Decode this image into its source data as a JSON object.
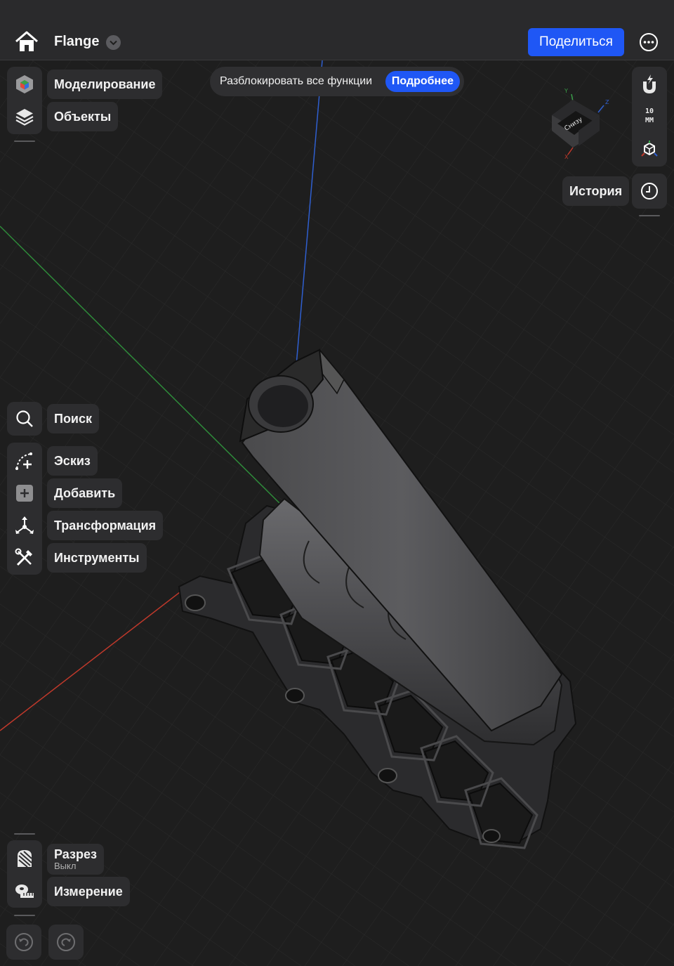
{
  "header": {
    "title": "Flange",
    "share_label": "Поделиться"
  },
  "banner": {
    "text": "Разблокировать все функции",
    "more_label": "Подробнее"
  },
  "top_left_menu": {
    "modeling_label": "Моделирование",
    "objects_label": "Объекты"
  },
  "tools_menu": {
    "search_label": "Поиск",
    "sketch_label": "Эскиз",
    "add_label": "Добавить",
    "transform_label": "Трансформация",
    "tools_label": "Инструменты"
  },
  "bottom_menu": {
    "section_label": "Разрез",
    "section_state": "Выкл",
    "measure_label": "Измерение"
  },
  "right_panel": {
    "units_value": "10",
    "units_label": "ММ",
    "history_label": "История",
    "view_cube_face": "Снизу"
  },
  "colors": {
    "accent": "#1f57f5",
    "panel": "#2d2d2f",
    "background": "#1e1e1e",
    "axis_x": "#c0392b",
    "axis_y": "#2e8b3a",
    "axis_z": "#2f5fd0"
  },
  "icons": [
    "home-icon",
    "chevron-down-icon",
    "more-icon",
    "modeling-cube-icon",
    "layers-icon",
    "search-icon",
    "sketch-icon",
    "add-icon",
    "transform-icon",
    "tools-icon",
    "section-icon",
    "measure-icon",
    "undo-icon",
    "redo-icon",
    "magnet-icon",
    "view-cube-icon",
    "origin-icon",
    "history-clock-icon"
  ]
}
